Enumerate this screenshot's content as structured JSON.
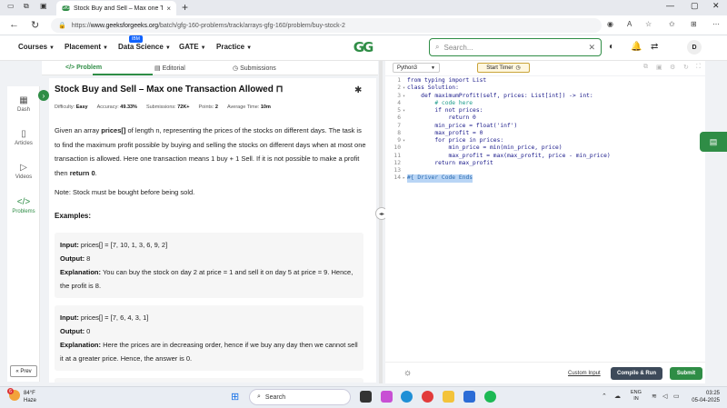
{
  "browser": {
    "tab_title": "Stock Buy and Sell – Max one Tra",
    "tab_favicon": "GfG",
    "new_tab": "+",
    "url_host": "www.geeksforgeeks.org",
    "url_prefix": "https://",
    "url_path": "/batch/gfg-160-problems/track/arrays-gfg-160/problem/buy-stock-2"
  },
  "header": {
    "menus": [
      "Courses",
      "Placement",
      "Data Science",
      "GATE",
      "Practice"
    ],
    "ibm_badge": "IBM",
    "logo": "GG",
    "search_placeholder": "Search...",
    "avatar": "D"
  },
  "rail": {
    "items": [
      {
        "label": "Dash",
        "icon": "dashboard-icon"
      },
      {
        "label": "Articles",
        "icon": "book-icon"
      },
      {
        "label": "Videos",
        "icon": "video-icon"
      },
      {
        "label": "Problems",
        "icon": "code-icon"
      }
    ],
    "prev_label": "« Prev"
  },
  "problem_tabs": [
    "Problem",
    "Editorial",
    "Submissions"
  ],
  "problem": {
    "title": "Stock Buy and Sell – Max one Transaction Allowed",
    "meta": {
      "difficulty_label": "Difficulty:",
      "difficulty": "Easy",
      "accuracy_label": "Accuracy:",
      "accuracy": "49.33%",
      "submissions_label": "Submissions:",
      "submissions": "72K+",
      "points_label": "Points:",
      "points": "2",
      "avg_time_label": "Average Time:",
      "avg_time": "10m"
    },
    "desc_1": "Given an array ",
    "desc_bold_1": "prices[]",
    "desc_2": " of length n, representing the prices of the stocks on different days. The task is to find the maximum profit possible by buying and selling the stocks on different days when at most one transaction is allowed. Here one transaction means 1 buy + 1 Sell. If it is not possible to make a profit then ",
    "desc_bold_2": "return 0",
    "desc_3": ".",
    "note": "Note: Stock must be bought before being sold.",
    "examples_heading": "Examples:",
    "examples": [
      {
        "input_label": "Input:",
        "input": "prices[] = [7, 10, 1, 3, 6, 9, 2]",
        "output_label": "Output:",
        "output": "8",
        "explanation_label": "Explanation:",
        "explanation": "You can buy the stock on day 2 at price = 1 and sell it on day 5 at price = 9. Hence, the profit is 8."
      },
      {
        "input_label": "Input:",
        "input": "prices[] = [7, 6, 4, 3, 1]",
        "output_label": "Output:",
        "output": "0",
        "explanation_label": "Explanation:",
        "explanation": "Here the prices are in decreasing order, hence if we buy any day then we cannot sell it at a greater price. Hence, the answer is 0."
      }
    ]
  },
  "editor": {
    "language": "Python3",
    "timer_label": "Start Timer",
    "lines": [
      {
        "n": "1",
        "fold": "",
        "text": "from typing import List",
        "cls": ""
      },
      {
        "n": "2",
        "fold": "▾",
        "text": "class Solution:",
        "cls": ""
      },
      {
        "n": "3",
        "fold": "▾",
        "text": "    def maximumProfit(self, prices: List[int]) -> int:",
        "cls": ""
      },
      {
        "n": "4",
        "fold": "",
        "text": "        # code here",
        "cls": "cm"
      },
      {
        "n": "5",
        "fold": "▾",
        "text": "        if not prices:",
        "cls": ""
      },
      {
        "n": "6",
        "fold": "",
        "text": "            return 0",
        "cls": ""
      },
      {
        "n": "7",
        "fold": "",
        "text": "        min_price = float('inf')",
        "cls": ""
      },
      {
        "n": "8",
        "fold": "",
        "text": "        max_profit = 0",
        "cls": ""
      },
      {
        "n": "9",
        "fold": "▾",
        "text": "        for price in prices:",
        "cls": ""
      },
      {
        "n": "10",
        "fold": "",
        "text": "            min_price = min(min_price, price)",
        "cls": ""
      },
      {
        "n": "11",
        "fold": "",
        "text": "            max_profit = max(max_profit, price - min_price)",
        "cls": ""
      },
      {
        "n": "12",
        "fold": "",
        "text": "        return max_profit",
        "cls": ""
      },
      {
        "n": "13",
        "fold": "",
        "text": "",
        "cls": ""
      },
      {
        "n": "14",
        "fold": "▸",
        "text": "#{ Driver Code Ends",
        "cls": "sel"
      }
    ],
    "custom_input": "Custom Input",
    "run_label": "Compile & Run",
    "submit_label": "Submit"
  },
  "taskbar": {
    "weather_temp": "84°F",
    "weather_desc": "Haze",
    "weather_badge": "6",
    "search_label": "Search",
    "lang_1": "ENG",
    "lang_2": "IN",
    "time": "03:25",
    "date": "05-04-2025"
  },
  "colors": {
    "brand_green": "#2f8d46",
    "run_button": "#3d4a5a"
  }
}
